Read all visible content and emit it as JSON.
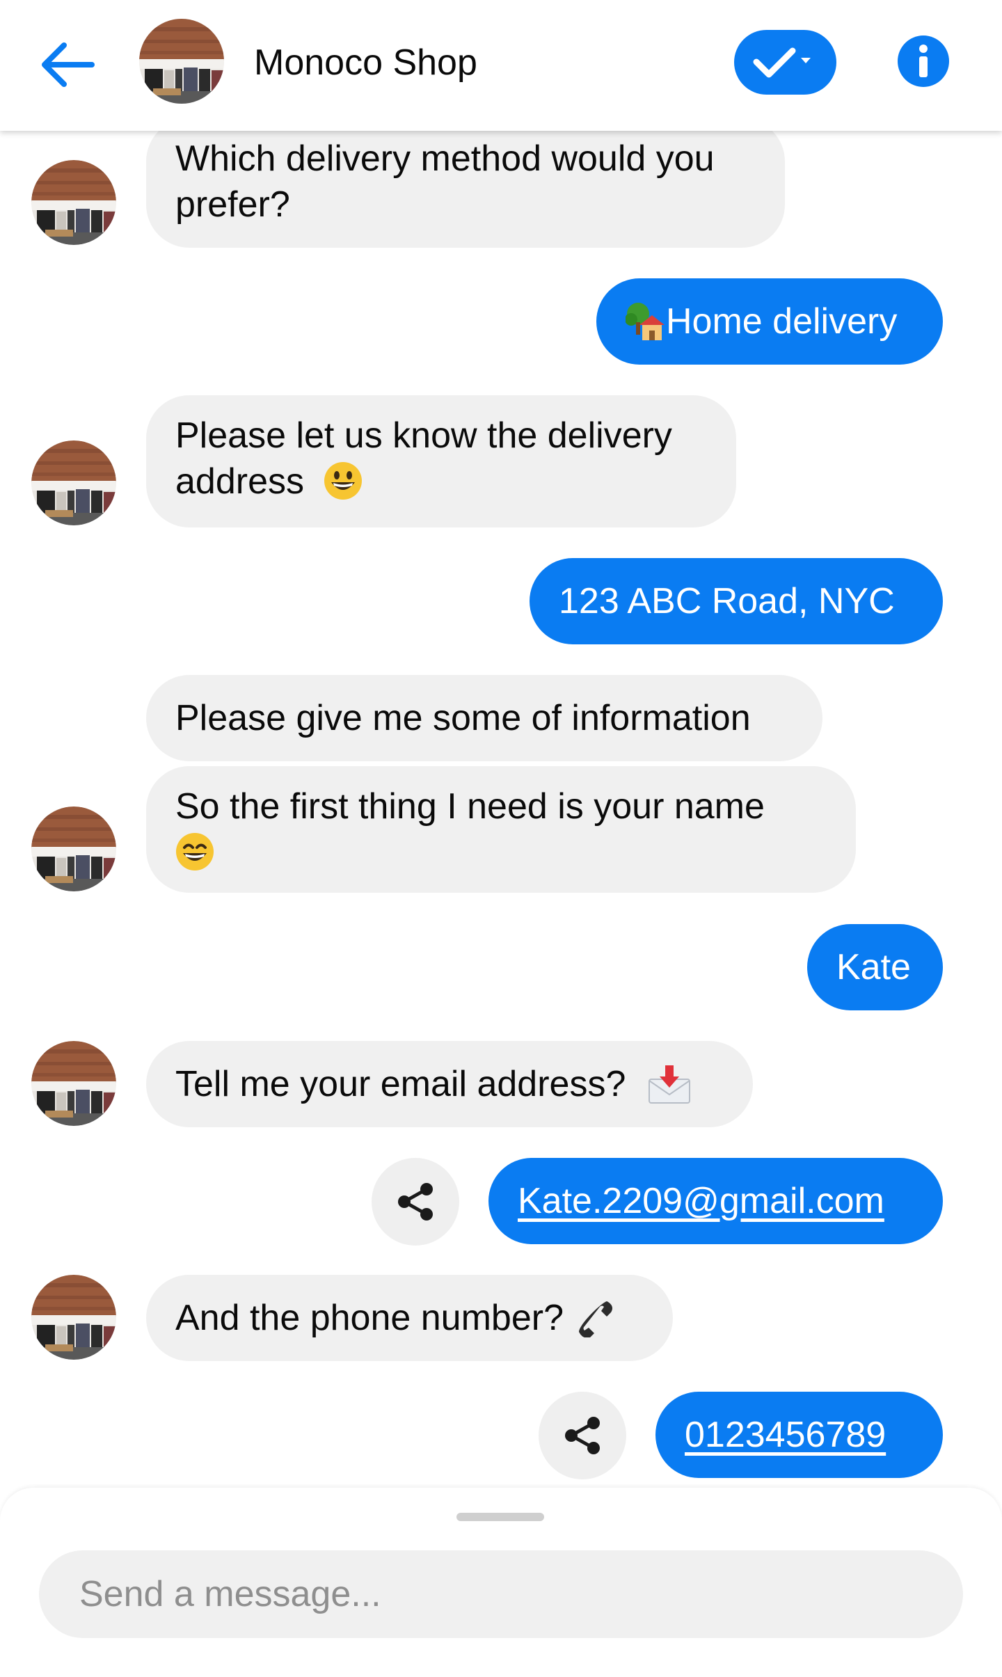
{
  "header": {
    "title": "Monoco Shop",
    "back_icon": "arrow-left-icon",
    "status_icon": "checkmark-dropdown-icon",
    "info_icon": "info-icon"
  },
  "messages": [
    {
      "from": "bot",
      "lines": [
        "Which delivery method would you",
        "prefer?"
      ]
    },
    {
      "from": "user",
      "text": "Home delivery",
      "emoji_icon": "house-with-garden-icon"
    },
    {
      "from": "bot",
      "lines": [
        "Please let us know the delivery",
        "address"
      ],
      "emoji_icon": "grinning-face-icon"
    },
    {
      "from": "user",
      "text": "123 ABC Road, NYC"
    },
    {
      "from": "bot",
      "text": "Please give me some of information"
    },
    {
      "from": "bot",
      "lines": [
        "So the first thing I need is your name"
      ],
      "emoji_icon": "smiling-face-icon"
    },
    {
      "from": "user",
      "text": "Kate"
    },
    {
      "from": "bot",
      "text": "Tell me your email address?",
      "emoji_icon": "incoming-envelope-icon"
    },
    {
      "from": "user",
      "text": "Kate.2209@gmail.com",
      "link": true,
      "share_icon": "share-icon"
    },
    {
      "from": "bot",
      "text": "And the phone number?",
      "emoji_icon": "telephone-receiver-icon"
    },
    {
      "from": "user",
      "text": "0123456789",
      "link": true,
      "share_icon": "share-icon"
    }
  ],
  "composer": {
    "placeholder": "Send a message..."
  },
  "colors": {
    "accent": "#0a7cf2",
    "bot_bubble": "#f0f0f0"
  }
}
